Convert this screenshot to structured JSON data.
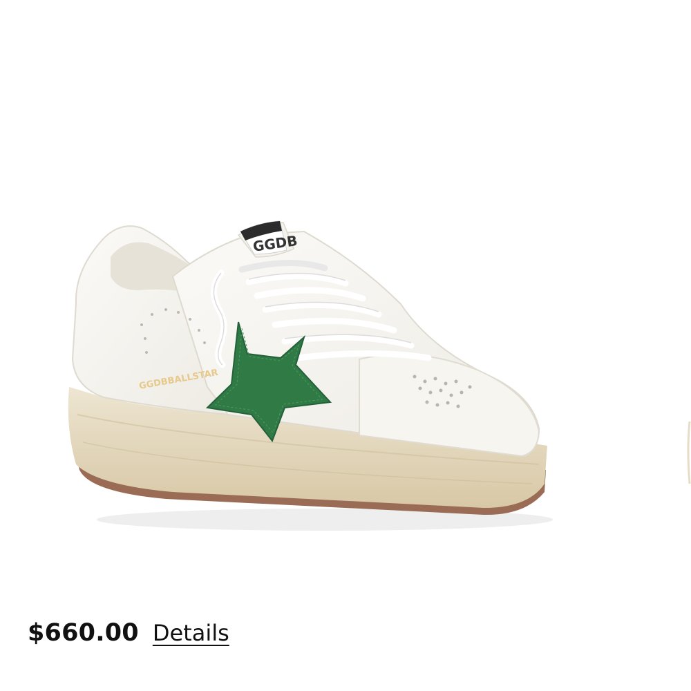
{
  "product": {
    "image_alt": "white leather sneaker with green star",
    "heel_tab_text": "GGDB",
    "side_text": "GGDBBALLSTAR",
    "star_color": "#2f7a45",
    "price": "$660.00",
    "details_label": "Details"
  }
}
